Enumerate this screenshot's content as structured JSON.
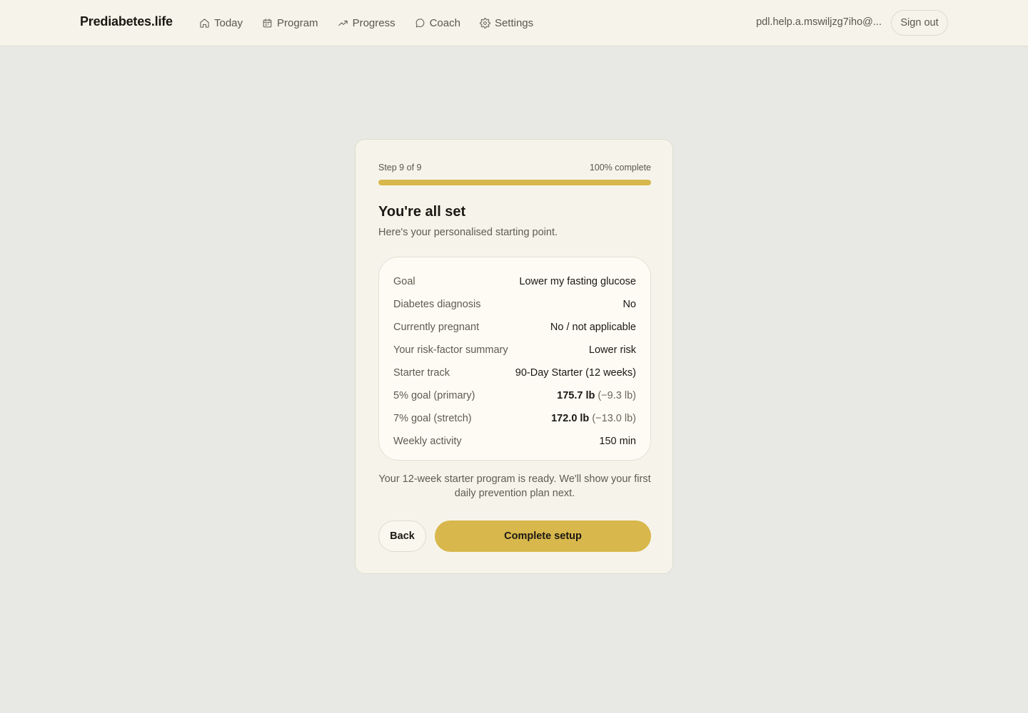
{
  "header": {
    "brand": "Prediabetes.life",
    "nav": [
      {
        "label": "Today",
        "icon": "home-icon"
      },
      {
        "label": "Program",
        "icon": "calendar-icon"
      },
      {
        "label": "Progress",
        "icon": "trending-up-icon"
      },
      {
        "label": "Coach",
        "icon": "chat-bubble-icon"
      },
      {
        "label": "Settings",
        "icon": "gear-icon"
      }
    ],
    "email": "pdl.help.a.mswiljzg7iho@...",
    "sign_out": "Sign out"
  },
  "onboarding": {
    "step_label": "Step 9 of 9",
    "percent_label": "100% complete",
    "progress_fraction": 1.0,
    "title": "You're all set",
    "subtitle": "Here's your personalised starting point.",
    "summary": [
      {
        "key": "Goal",
        "value": "Lower my fasting glucose"
      },
      {
        "key": "Diabetes diagnosis",
        "value": "No"
      },
      {
        "key": "Currently pregnant",
        "value": "No / not applicable"
      },
      {
        "key": "Your risk-factor summary",
        "value": "Lower risk"
      },
      {
        "key": "Starter track",
        "value": "90-Day Starter (12 weeks)"
      },
      {
        "key": "5% goal (primary)",
        "value": "175.7 lb",
        "delta": "(−9.3 lb)"
      },
      {
        "key": "7% goal (stretch)",
        "value": "172.0 lb",
        "delta": "(−13.0 lb)"
      },
      {
        "key": "Weekly activity",
        "value": "150 min"
      }
    ],
    "note": "Your 12-week starter program is ready. We'll show your first daily prevention plan next.",
    "back_label": "Back",
    "complete_label": "Complete setup"
  },
  "colors": {
    "accent": "#d8b74c",
    "page_bg": "#e8e9e4",
    "header_bg": "#f6f4ea",
    "card_bg": "#f6f4ea"
  }
}
